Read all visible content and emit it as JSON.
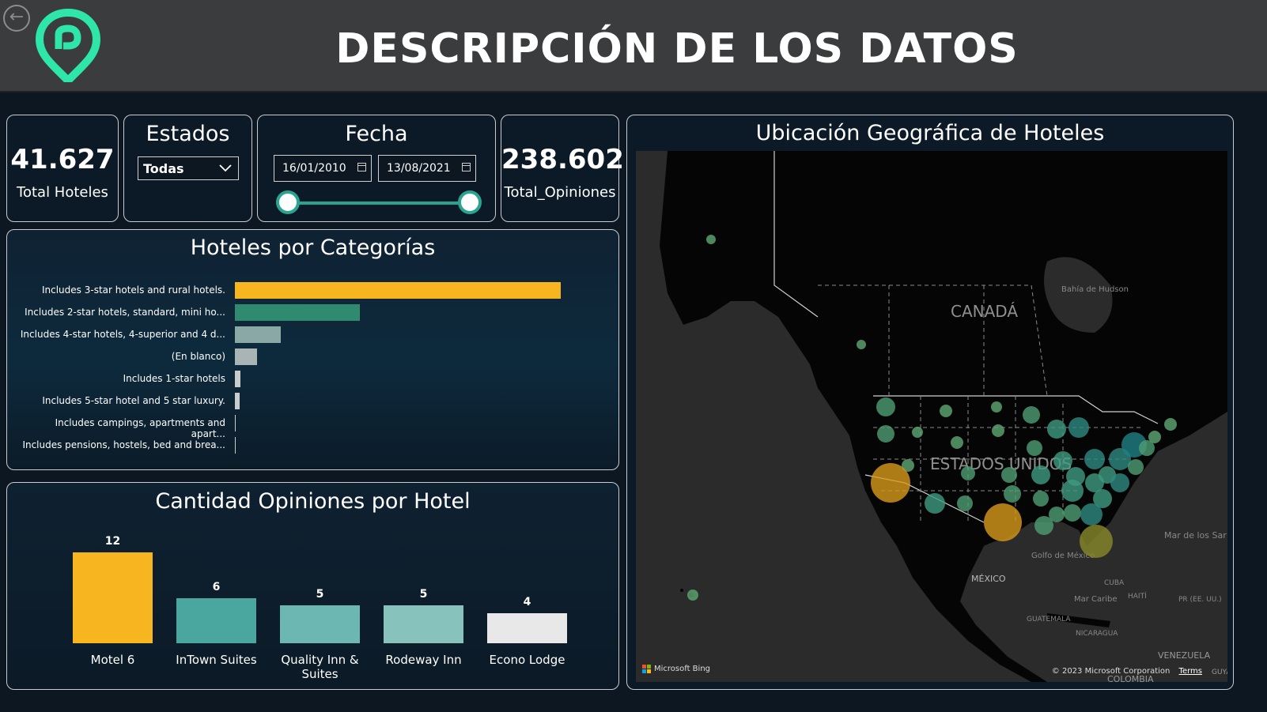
{
  "header": {
    "title": "DESCRIPCIÓN DE LOS DATOS",
    "back_icon": "back-arrow-icon"
  },
  "colors": {
    "accent": "#2aa38f",
    "highlight": "#f7b520",
    "brand": "#2ee6a8"
  },
  "kpis": {
    "total_hoteles": {
      "value": "41.627",
      "label": "Total Hoteles"
    },
    "total_opiniones": {
      "value": "238.602",
      "label": "Total_Opiniones"
    }
  },
  "filters": {
    "estados": {
      "title": "Estados",
      "selected": "Todas"
    },
    "fecha": {
      "title": "Fecha",
      "start": "16/01/2010",
      "end": "13/08/2021"
    }
  },
  "chart_data": [
    {
      "type": "bar",
      "orientation": "horizontal",
      "title": "Hoteles por Categorías",
      "categories": [
        "Includes 3-star hotels and rural hotels.",
        "Includes 2-star hotels, standard, mini ho...",
        "Includes 4-star hotels, 4-superior and 4 d...",
        "(En blanco)",
        "Includes 1-star hotels",
        "Includes 5-star hotel and 5 star luxury.",
        "Includes campings, apartments and apart...",
        "Includes pensions, hostels, bed and brea..."
      ],
      "values": [
        26400,
        10100,
        3700,
        1800,
        450,
        400,
        40,
        20
      ],
      "colors": [
        "#f7b520",
        "#2f8a70",
        "#8aa9a5",
        "#a9b4b4",
        "#c8cccc",
        "#c8cccc",
        "#c8cccc",
        "#c8cccc"
      ]
    },
    {
      "type": "bar",
      "title": "Cantidad Opiniones por Hotel",
      "categories": [
        "Motel 6",
        "InTown Suites",
        "Quality Inn & Suites",
        "Rodeway Inn",
        "Econo Lodge"
      ],
      "values": [
        12,
        6,
        5,
        5,
        4
      ],
      "colors": [
        "#f7b520",
        "#4aa7a0",
        "#6cb7b1",
        "#87c2bd",
        "#e8e8e8"
      ]
    }
  ],
  "map": {
    "title": "Ubicación Geográfica de Hoteles",
    "labels": [
      "CANADÁ",
      "ESTADOS UNIDOS",
      "MÉXICO",
      "Bahía de Hudson",
      "Golfo de México",
      "Mar Caribe",
      "Mar de los Sar",
      "CUBA",
      "HAITÍ",
      "PR (EE. UU.)",
      "GUATEMALA",
      "NICARAGUA",
      "VENEZUELA",
      "COLOMBIA",
      "GUYA"
    ],
    "attribution": "Microsoft Bing",
    "copyright": "© 2023 Microsoft Corporation",
    "terms": "Terms"
  }
}
